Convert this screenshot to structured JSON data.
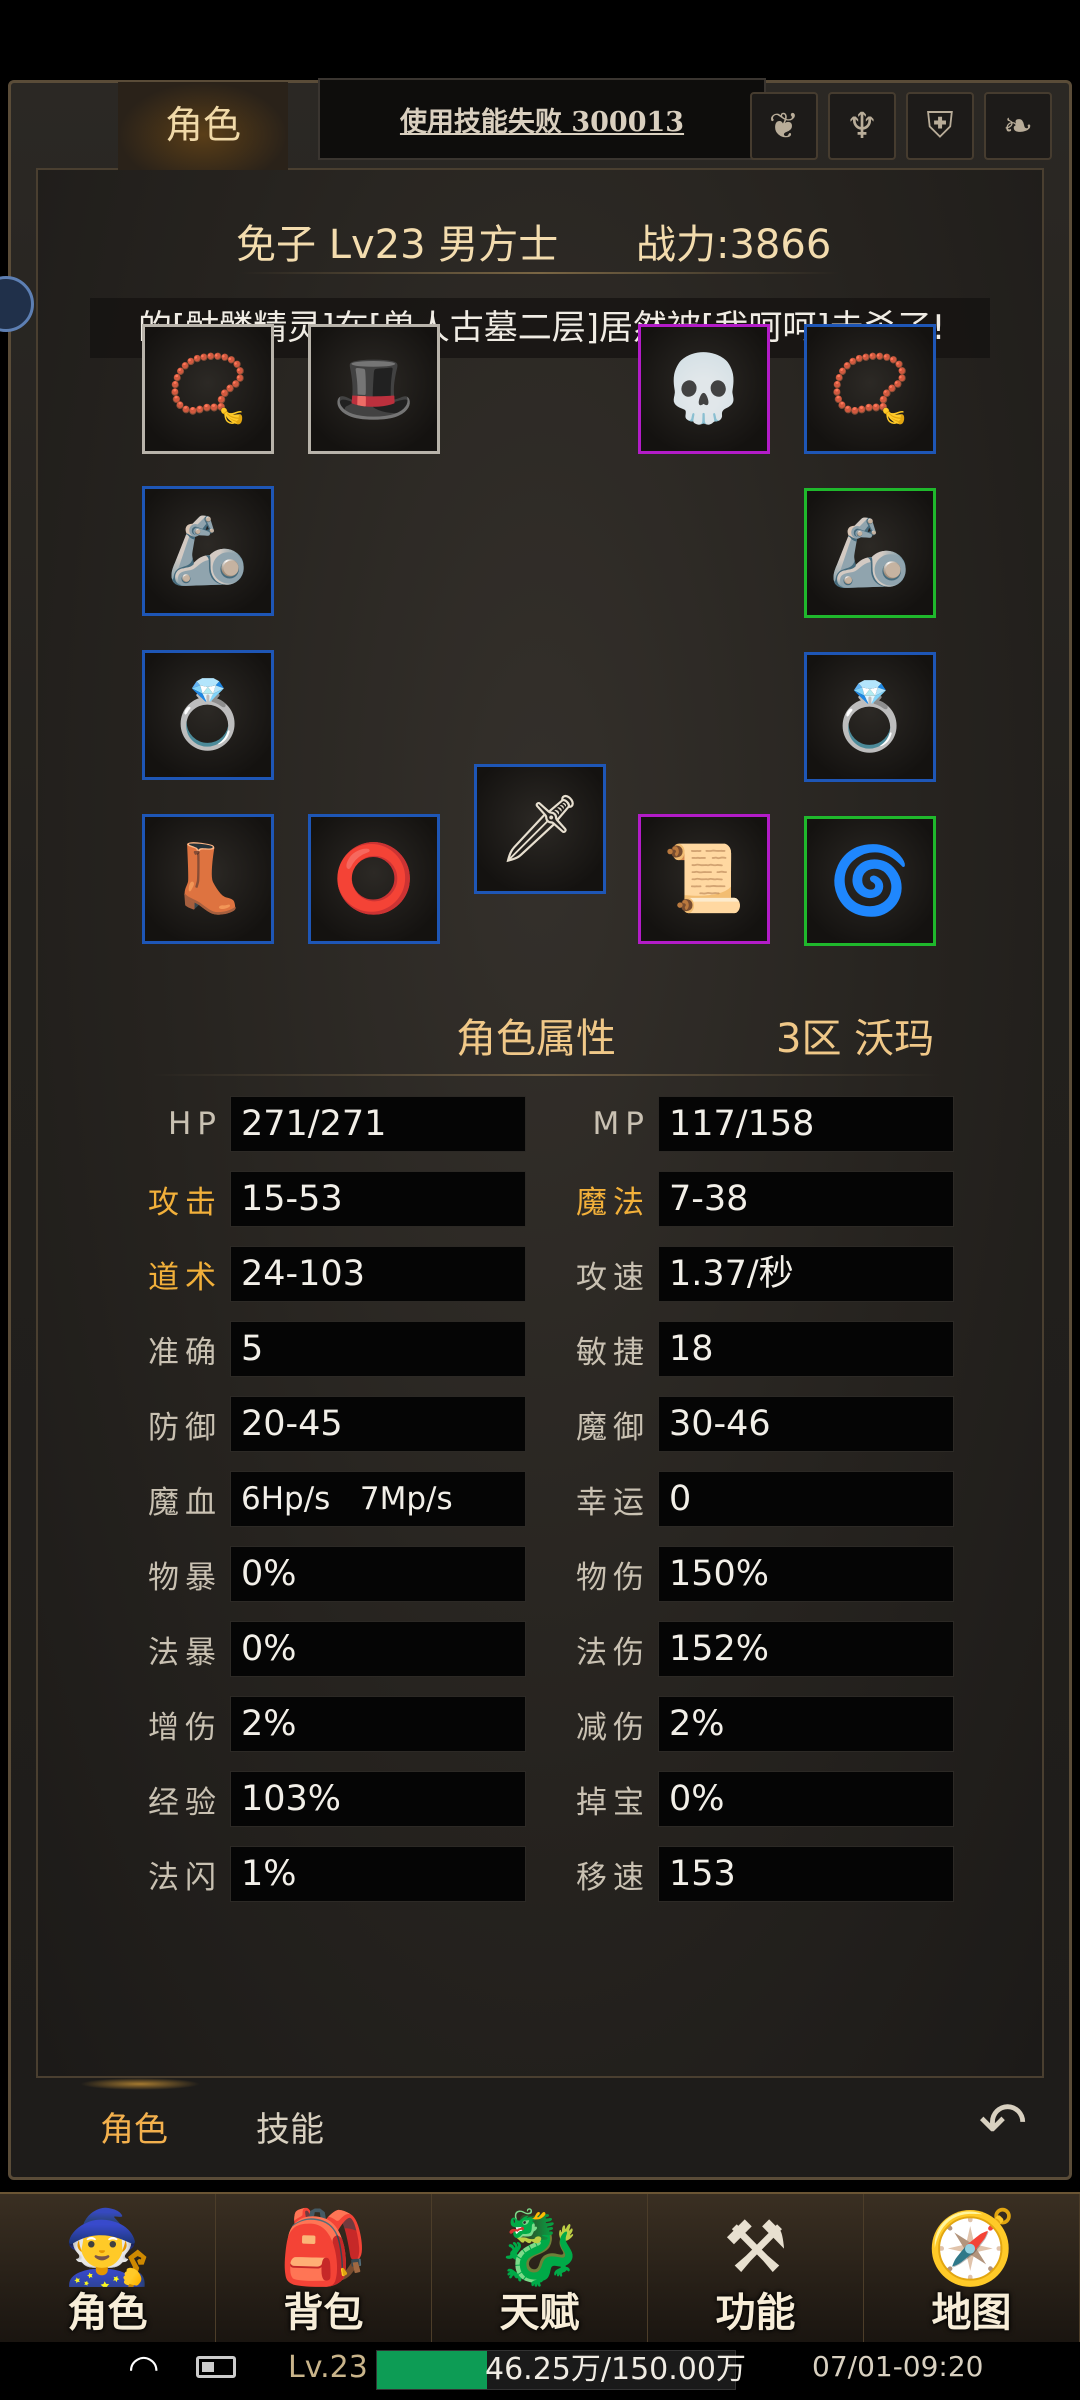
{
  "top_tab": {
    "label": "角色"
  },
  "toast": {
    "text": "使用技能失败 300013"
  },
  "top_icons": [
    "bird-icon",
    "trident-icon",
    "shield-icon",
    "feather-icon"
  ],
  "header": {
    "character": "免子 Lv23 男方士",
    "power": "战力:3866"
  },
  "broadcast": "的[骷髅精灵]在[兽人古墓二层]居然被[我呵呵]击杀了!",
  "equipment": [
    {
      "slot": "amulet",
      "icon": "amulet-icon",
      "glyph": "📿",
      "quality": "white"
    },
    {
      "slot": "helmet",
      "icon": "hat-icon",
      "glyph": "🎩",
      "quality": "white"
    },
    {
      "slot": "mask",
      "icon": "skull-helm-icon",
      "glyph": "💀",
      "quality": "purple"
    },
    {
      "slot": "necklace",
      "icon": "necklace-icon",
      "glyph": "📿",
      "quality": "blue"
    },
    {
      "slot": "left-bracer",
      "icon": "bracer-icon",
      "glyph": "🦾",
      "quality": "blue"
    },
    {
      "slot": "right-bracer",
      "icon": "bracer-icon",
      "glyph": "🦾",
      "quality": "green"
    },
    {
      "slot": "left-ring",
      "icon": "ring-icon",
      "glyph": "💍",
      "quality": "blue"
    },
    {
      "slot": "right-ring",
      "icon": "ring-icon",
      "glyph": "💍",
      "quality": "blue"
    },
    {
      "slot": "boots",
      "icon": "boots-icon",
      "glyph": "👢",
      "quality": "blue"
    },
    {
      "slot": "belt",
      "icon": "belt-icon",
      "glyph": "⭕",
      "quality": "blue"
    },
    {
      "slot": "weapon",
      "icon": "dagger-icon",
      "glyph": "🗡",
      "quality": "blue"
    },
    {
      "slot": "scroll",
      "icon": "scroll-icon",
      "glyph": "📜",
      "quality": "purple"
    },
    {
      "slot": "gem",
      "icon": "gem-icon",
      "glyph": "🌀",
      "quality": "green"
    }
  ],
  "attributes": {
    "title": "角色属性",
    "server": "3区 沃玛",
    "left": [
      {
        "label": "HP",
        "value": "271/271",
        "highlight": false
      },
      {
        "label": "攻击",
        "value": "15-53",
        "highlight": true
      },
      {
        "label": "道术",
        "value": "24-103",
        "highlight": true
      },
      {
        "label": "准确",
        "value": "5",
        "highlight": false
      },
      {
        "label": "防御",
        "value": "20-45",
        "highlight": false
      },
      {
        "label": "魔血",
        "value": "6Hp/s   7Mp/s",
        "highlight": false
      },
      {
        "label": "物暴",
        "value": "0%",
        "highlight": false
      },
      {
        "label": "法暴",
        "value": "0%",
        "highlight": false
      },
      {
        "label": "增伤",
        "value": "2%",
        "highlight": false
      },
      {
        "label": "经验",
        "value": "103%",
        "highlight": false
      },
      {
        "label": "法闪",
        "value": "1%",
        "highlight": false
      }
    ],
    "right": [
      {
        "label": "MP",
        "value": "117/158",
        "highlight": false
      },
      {
        "label": "魔法",
        "value": "7-38",
        "highlight": true
      },
      {
        "label": "攻速",
        "value": "1.37/秒",
        "highlight": false
      },
      {
        "label": "敏捷",
        "value": "18",
        "highlight": false
      },
      {
        "label": "魔御",
        "value": "30-46",
        "highlight": false
      },
      {
        "label": "幸运",
        "value": "0",
        "highlight": false
      },
      {
        "label": "物伤",
        "value": "150%",
        "highlight": false
      },
      {
        "label": "法伤",
        "value": "152%",
        "highlight": false
      },
      {
        "label": "减伤",
        "value": "2%",
        "highlight": false
      },
      {
        "label": "掉宝",
        "value": "0%",
        "highlight": false
      },
      {
        "label": "移速",
        "value": "153",
        "highlight": false
      }
    ]
  },
  "bottom_tabs": {
    "role": "角色",
    "skill": "技能"
  },
  "nav": [
    {
      "label": "角色",
      "icon": "hooded-character-icon",
      "glyph": "🧙"
    },
    {
      "label": "背包",
      "icon": "bag-potion-icon",
      "glyph": "🎒"
    },
    {
      "label": "天赋",
      "icon": "talent-dragon-icon",
      "glyph": "🐉"
    },
    {
      "label": "功能",
      "icon": "anvil-icon",
      "glyph": "⚒"
    },
    {
      "label": "地图",
      "icon": "map-compass-icon",
      "glyph": "🧭"
    }
  ],
  "status": {
    "level": "Lv.23",
    "exp_text": "46.25万/150.00万",
    "exp_fraction": 0.308,
    "time": "07/01-09:20"
  }
}
